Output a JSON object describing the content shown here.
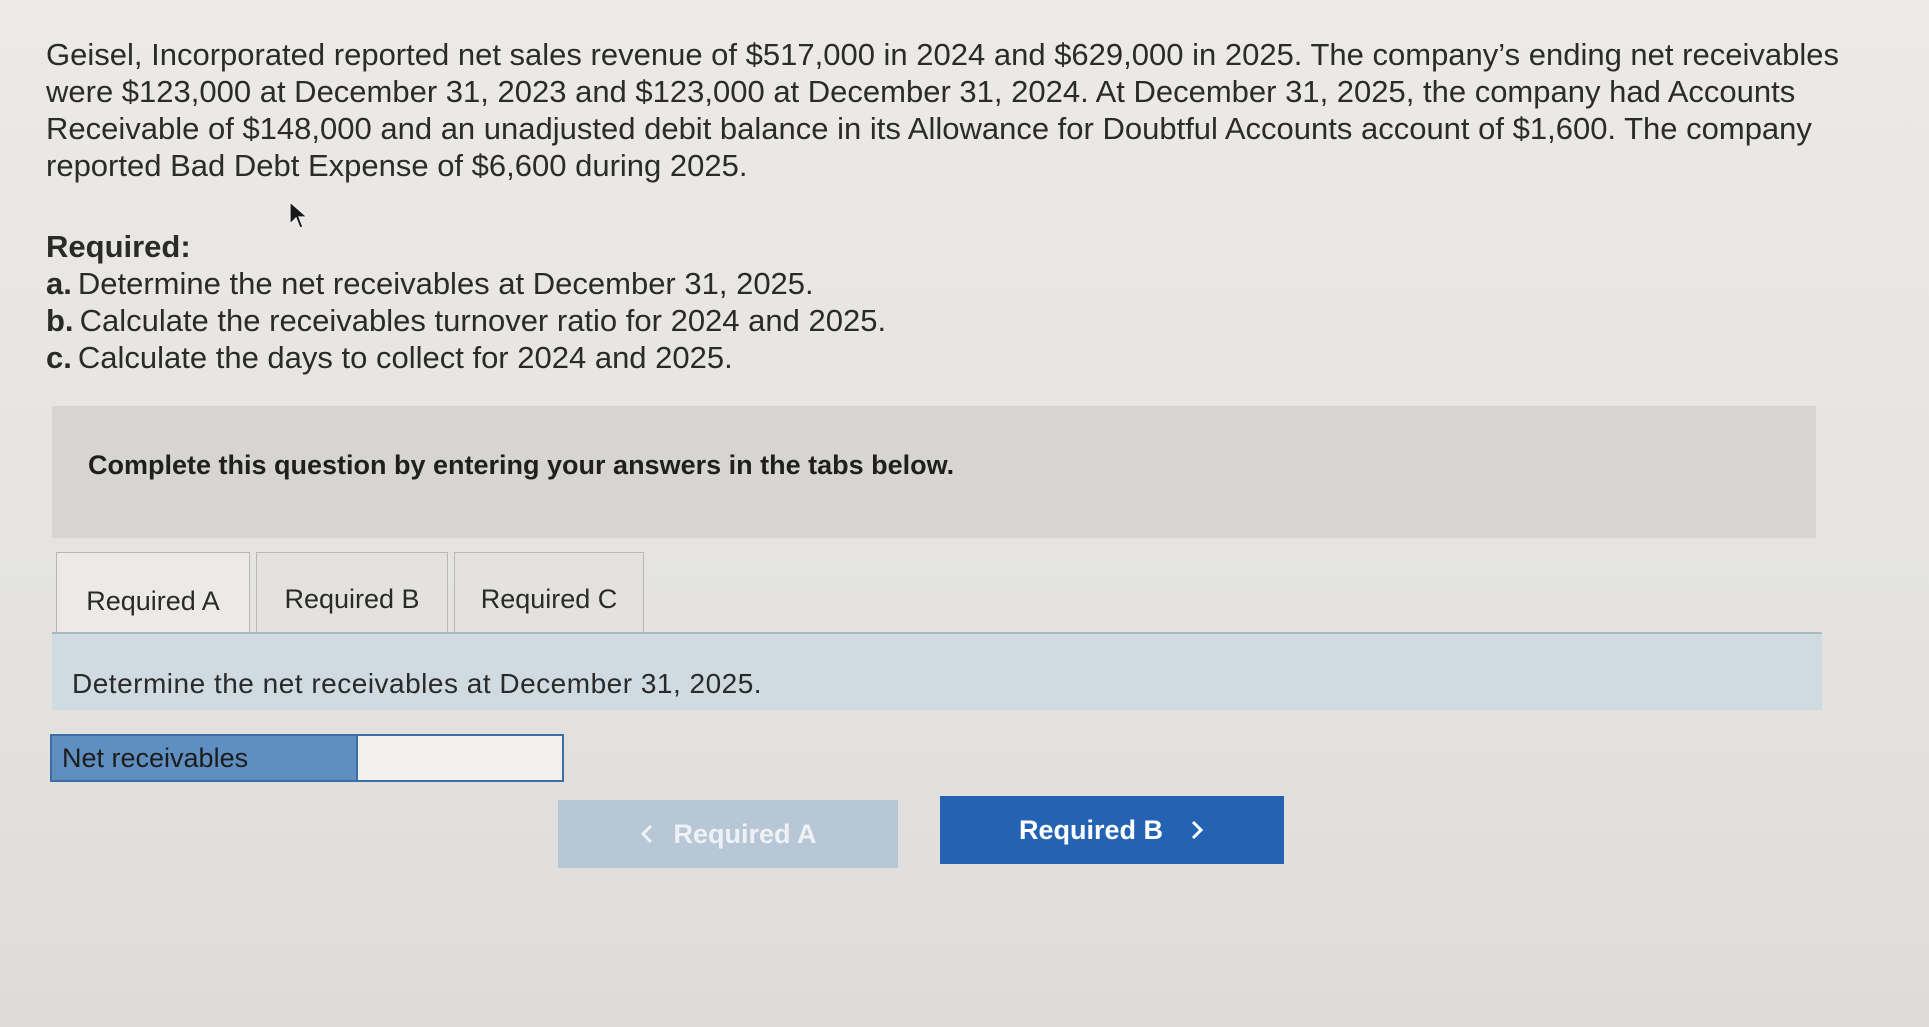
{
  "problem": {
    "line1": "Geisel, Incorporated reported net sales revenue of $517,000 in 2024 and $629,000 in 2025. The company’s ending net receivables",
    "line2": "were $123,000 at December 31, 2023 and $123,000 at December 31, 2024. At December 31, 2025, the company had Accounts",
    "line3": "Receivable of $148,000 and an unadjusted debit balance in its Allowance for Doubtful Accounts account of $1,600. The company",
    "line4": "reported Bad Debt Expense of $6,600 during 2025."
  },
  "required": {
    "heading": "Required:",
    "items": [
      {
        "letter": "a.",
        "text": "Determine the net receivables at December 31, 2025."
      },
      {
        "letter": "b.",
        "text": "Calculate the receivables turnover ratio for 2024 and 2025."
      },
      {
        "letter": "c.",
        "text": "Calculate the days to collect for 2024 and 2025."
      }
    ]
  },
  "instruction": "Complete this question by entering your answers in the tabs below.",
  "tabs": [
    {
      "label": "Required A",
      "active": true
    },
    {
      "label": "Required B",
      "active": false
    },
    {
      "label": "Required C",
      "active": false
    }
  ],
  "panel": {
    "prompt": "Determine the net receivables at December 31, 2025."
  },
  "answer": {
    "label": "Net receivables",
    "value": ""
  },
  "nav": {
    "prev_label": "Required A",
    "next_label": "Required B"
  },
  "icons": {
    "cursor": "mouse-pointer-icon",
    "prev": "chevron-left-icon",
    "next": "chevron-right-icon"
  },
  "colors": {
    "primary_button": "#2463b4",
    "disabled_button": "#b7c7d6",
    "answer_label_bg": "#5f8fc0",
    "panel_bg": "#cfdbe0"
  }
}
